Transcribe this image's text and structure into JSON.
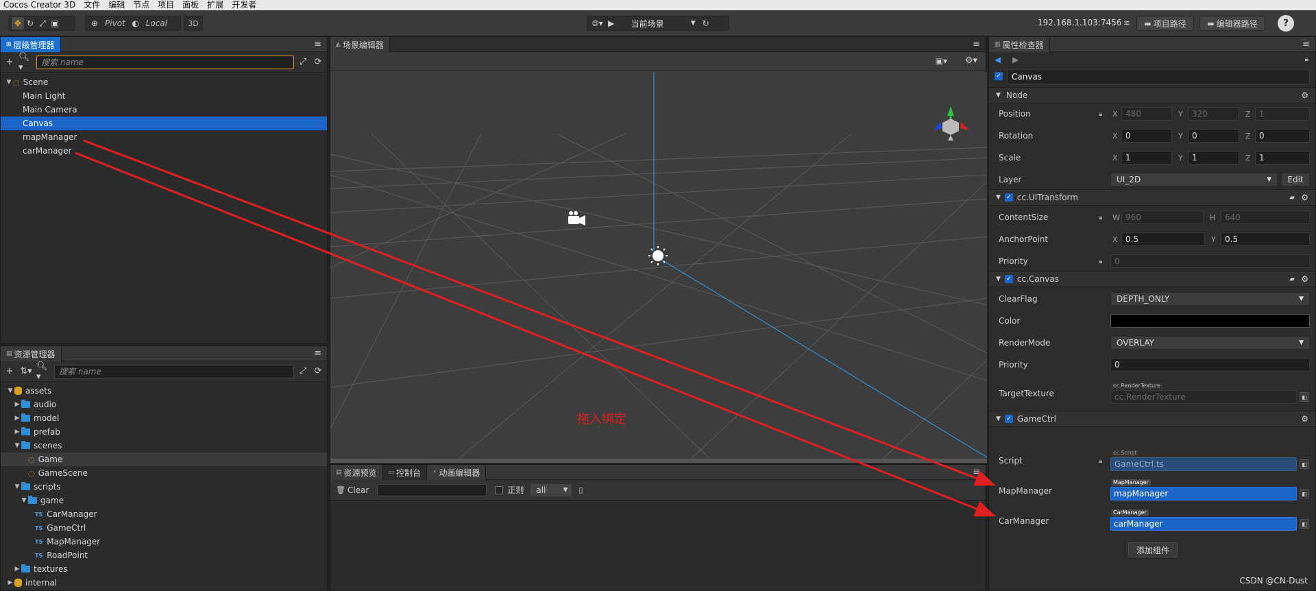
{
  "menubar": {
    "items": [
      "Cocos Creator 3D",
      "文件",
      "编辑",
      "节点",
      "项目",
      "面板",
      "扩展",
      "开发者"
    ]
  },
  "toolbar": {
    "pivot_label": "Pivot",
    "local_label": "Local",
    "mode_3d_label": "3D",
    "scene_select": "当前场景",
    "ip_address": "192.168.1.103:7456",
    "project_path_label": "项目路径",
    "editor_path_label": "编辑器路径",
    "help_label": "?"
  },
  "hierarchy": {
    "title": "层级管理器",
    "search_placeholder": "搜索 name",
    "nodes": [
      {
        "label": "Scene",
        "depth": 0,
        "expanded": true,
        "selected": false
      },
      {
        "label": "Main Light",
        "depth": 1,
        "selected": false
      },
      {
        "label": "Main Camera",
        "depth": 1,
        "selected": false
      },
      {
        "label": "Canvas",
        "depth": 1,
        "selected": true
      },
      {
        "label": "mapManager",
        "depth": 1,
        "selected": false
      },
      {
        "label": "carManager",
        "depth": 1,
        "selected": false
      }
    ]
  },
  "assets": {
    "title": "资源管理器",
    "search_placeholder": "搜索 name",
    "items": [
      {
        "label": "assets",
        "kind": "db",
        "depth": 0,
        "arrow": "down"
      },
      {
        "label": "audio",
        "kind": "folder",
        "depth": 1,
        "arrow": "right"
      },
      {
        "label": "model",
        "kind": "folder",
        "depth": 1,
        "arrow": "right"
      },
      {
        "label": "prefab",
        "kind": "folder",
        "depth": 1,
        "arrow": "right"
      },
      {
        "label": "scenes",
        "kind": "folder",
        "depth": 1,
        "arrow": "down"
      },
      {
        "label": "Game",
        "kind": "scene",
        "depth": 2,
        "highlight": true
      },
      {
        "label": "GameScene",
        "kind": "scene",
        "depth": 2
      },
      {
        "label": "scripts",
        "kind": "folder",
        "depth": 1,
        "arrow": "down"
      },
      {
        "label": "game",
        "kind": "folder",
        "depth": 2,
        "arrow": "down"
      },
      {
        "label": "CarManager",
        "kind": "ts",
        "depth": 3
      },
      {
        "label": "GameCtrl",
        "kind": "ts",
        "depth": 3
      },
      {
        "label": "MapManager",
        "kind": "ts",
        "depth": 3
      },
      {
        "label": "RoadPoint",
        "kind": "ts",
        "depth": 3
      },
      {
        "label": "textures",
        "kind": "folder",
        "depth": 1,
        "arrow": "right"
      },
      {
        "label": "internal",
        "kind": "db",
        "depth": 0,
        "arrow": "right"
      }
    ]
  },
  "scene_editor": {
    "title": "场景编辑器",
    "annotation": "拖入绑定",
    "annotation_color": "#e02020"
  },
  "console": {
    "tabs": [
      "资源预览",
      "控制台",
      "动画编辑器"
    ],
    "clear_label": "Clear",
    "regex_label": "正则",
    "filter_value": "all"
  },
  "inspector": {
    "title": "属性检查器",
    "node_name": "Canvas",
    "node_section": "Node",
    "position": {
      "label": "Position",
      "x": "480",
      "y": "320",
      "z": "1"
    },
    "rotation": {
      "label": "Rotation",
      "x": "0",
      "y": "0",
      "z": "0"
    },
    "scale": {
      "label": "Scale",
      "x": "1",
      "y": "1",
      "z": "1"
    },
    "layer": {
      "label": "Layer",
      "value": "UI_2D",
      "edit_label": "Edit"
    },
    "uitransform": {
      "title": "cc.UITransform",
      "content_size_label": "ContentSize",
      "w_label": "W",
      "w": "960",
      "h_label": "H",
      "h": "640",
      "anchor_label": "AnchorPoint",
      "anchor_x": "0.5",
      "anchor_y": "0.5",
      "priority_label": "Priority",
      "priority": "0"
    },
    "canvas": {
      "title": "cc.Canvas",
      "clearflag_label": "ClearFlag",
      "clearflag": "DEPTH_ONLY",
      "color_label": "Color",
      "color": "#000000",
      "rendermode_label": "RenderMode",
      "rendermode": "OVERLAY",
      "priority_label": "Priority",
      "priority": "0",
      "target_texture_label": "TargetTexture",
      "target_texture_tag": "cc.RenderTexture",
      "target_texture_value": "cc.RenderTexture"
    },
    "gamectrl": {
      "title": "GameCtrl",
      "script_label": "Script",
      "script_tag": "cc.Script",
      "script_value": "GameCtrl.ts",
      "map_label": "MapManager",
      "map_tag": "MapManager",
      "map_value": "mapManager",
      "car_label": "CarManager",
      "car_tag": "CarManager",
      "car_value": "carManager"
    },
    "add_component_label": "添加组件"
  },
  "watermark": "CSDN @CN-Dust"
}
